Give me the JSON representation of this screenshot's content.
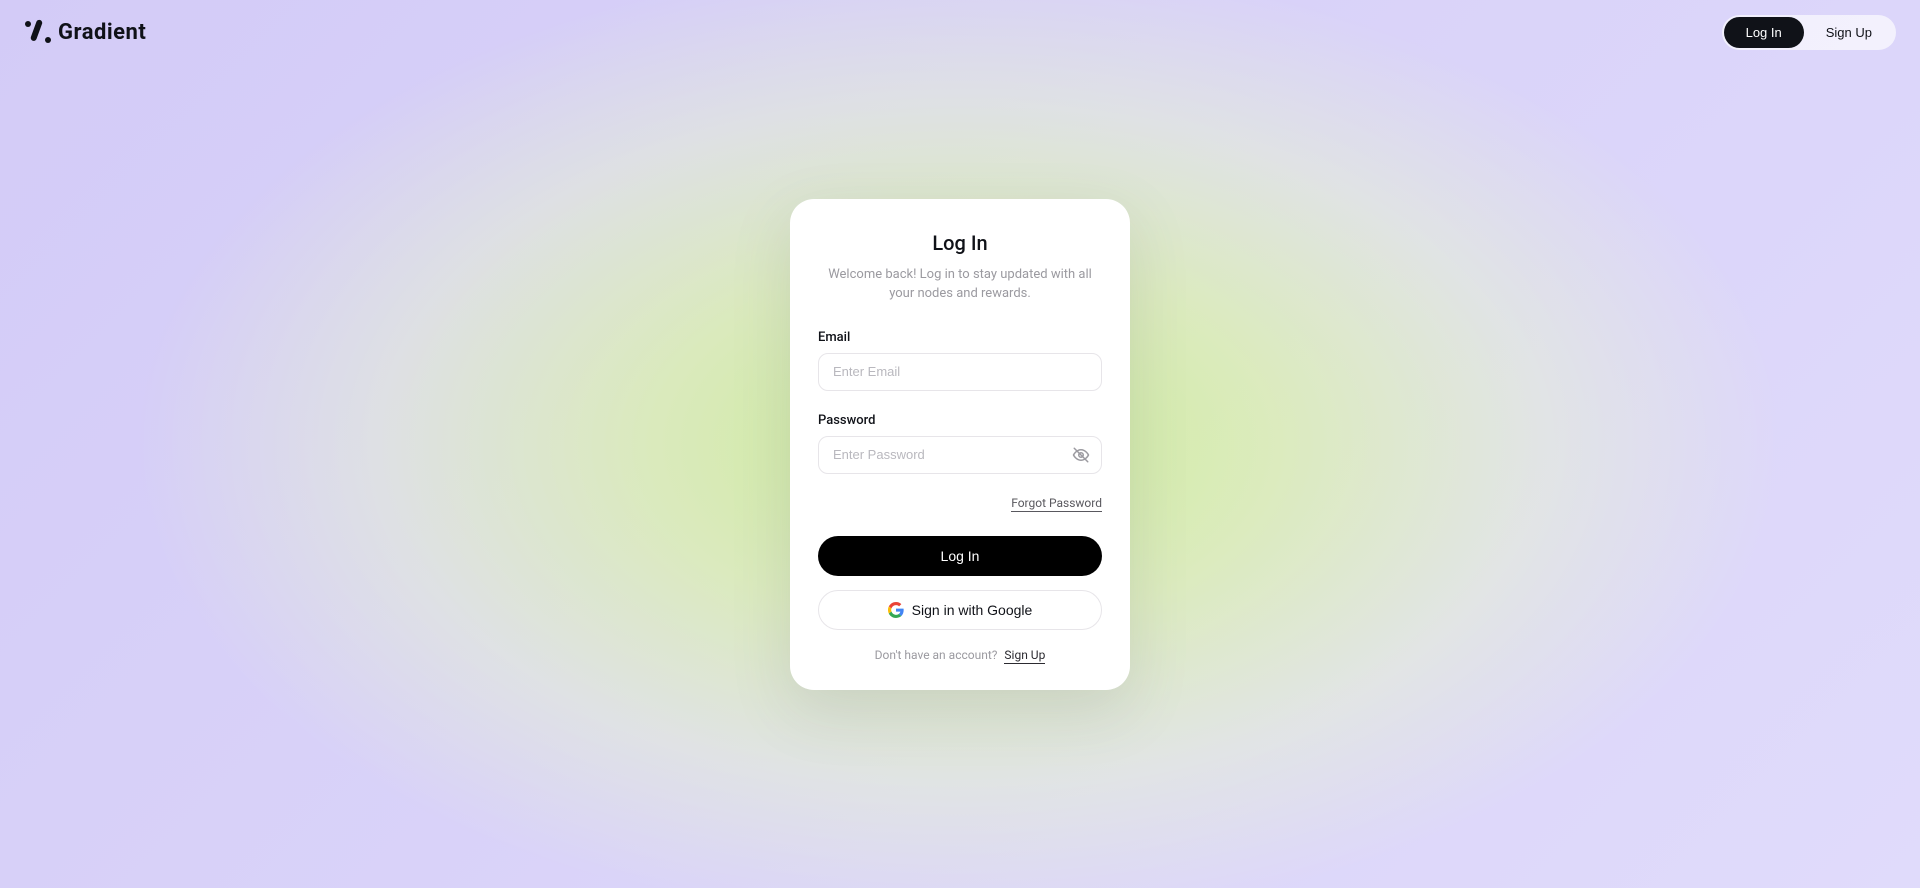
{
  "header": {
    "brand_name": "Gradient",
    "login_label": "Log In",
    "signup_label": "Sign Up"
  },
  "card": {
    "title": "Log In",
    "subtitle": "Welcome back! Log in to stay updated with all your nodes and rewards.",
    "email": {
      "label": "Email",
      "placeholder": "Enter Email",
      "value": ""
    },
    "password": {
      "label": "Password",
      "placeholder": "Enter Password",
      "value": ""
    },
    "forgot_label": "Forgot Password",
    "submit_label": "Log In",
    "google_label": "Sign in with Google",
    "no_account_text": "Don't have an account?",
    "signup_link_label": "Sign Up"
  }
}
